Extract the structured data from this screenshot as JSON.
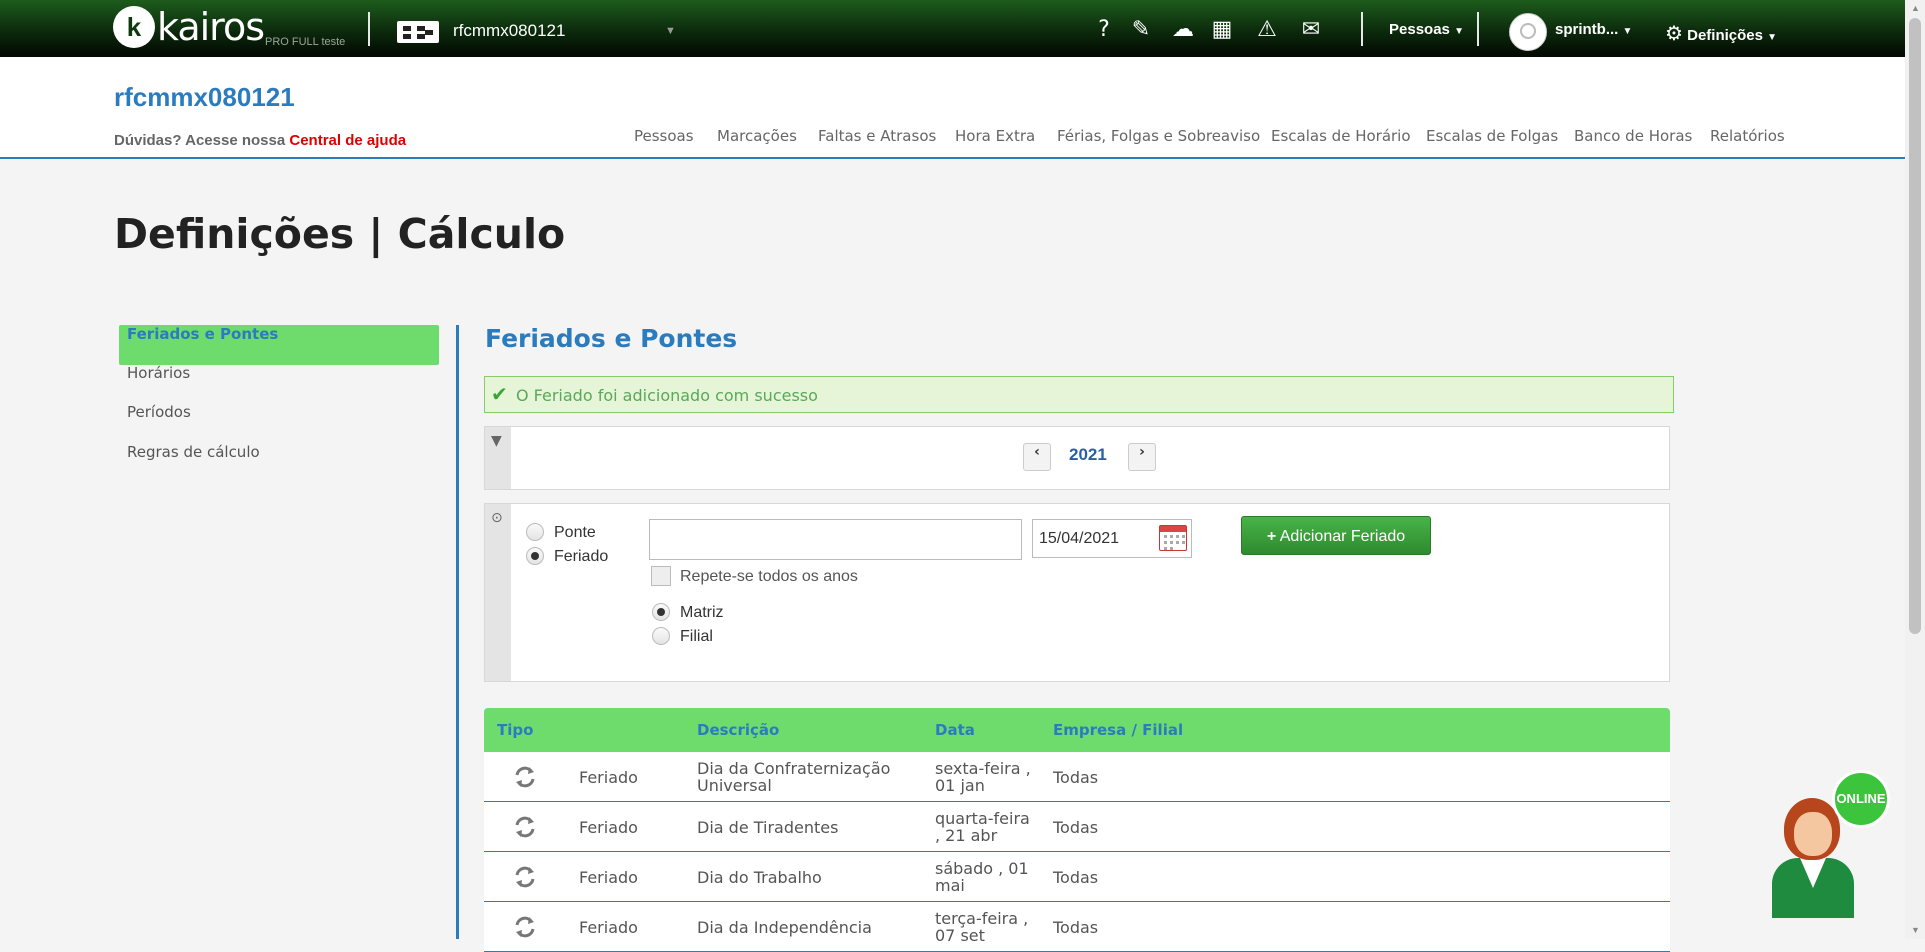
{
  "topbar": {
    "logo_text": "kairos",
    "logo_sub": "PRO FULL teste",
    "company": "rfcmmx080121",
    "icons": [
      "help-icon",
      "chat-support-icon",
      "cloud-upload-icon",
      "calculator-icon",
      "warning-icon",
      "inbox-icon"
    ],
    "icon_glyphs": [
      "?",
      "✎",
      "☁",
      "▦",
      "⚠",
      "✉"
    ],
    "people_menu": "Pessoas",
    "user_name": "sprintb...",
    "settings_menu": "Definições"
  },
  "header": {
    "title": "rfcmmx080121",
    "help_prefix": "Dúvidas? Acesse nossa",
    "help_link": "Central de ajuda",
    "nav": [
      "Pessoas",
      "Marcações",
      "Faltas e Atrasos",
      "Hora Extra",
      "Férias, Folgas e Sobreaviso",
      "Escalas de Horário",
      "Escalas de Folgas",
      "Banco de Horas",
      "Relatórios"
    ]
  },
  "page_title": "Definições | Cálculo",
  "sidebar": {
    "items": [
      "Feriados e Pontes",
      "Horários",
      "Períodos",
      "Regras de cálculo"
    ]
  },
  "section": {
    "title": "Feriados e Pontes",
    "alert": "O Feriado foi adicionado com sucesso"
  },
  "year_filter": {
    "year": "2021",
    "prev": "‹",
    "next": "›"
  },
  "form": {
    "type_bridge": "Ponte",
    "type_holiday": "Feriado",
    "description_value": "",
    "date_value": "15/04/2021",
    "repeat_label": "Repete-se todos os anos",
    "scope_head": "Matriz",
    "scope_branch": "Filial",
    "add_button": "Adicionar Feriado",
    "add_icon": "+"
  },
  "table": {
    "headers": [
      "Tipo",
      "Descrição",
      "Data",
      "Empresa / Filial"
    ],
    "rows": [
      {
        "type": "Feriado",
        "description_1": "Dia da Confraternização",
        "description_2": "Universal",
        "date_1": "sexta-feira ,",
        "date_2": "01 jan",
        "company": "Todas"
      },
      {
        "type": "Feriado",
        "description_1": "Dia de Tiradentes",
        "description_2": "",
        "date_1": "quarta-feira",
        "date_2": ", 21 abr",
        "company": "Todas"
      },
      {
        "type": "Feriado",
        "description_1": "Dia do Trabalho",
        "description_2": "",
        "date_1": "sábado , 01",
        "date_2": "mai",
        "company": "Todas"
      },
      {
        "type": "Feriado",
        "description_1": "Dia da Independência",
        "description_2": "",
        "date_1": "terça-feira ,",
        "date_2": "07 set",
        "company": "Todas"
      }
    ]
  },
  "chat": {
    "status": "ONLINE"
  },
  "colors": {
    "accent_blue": "#2b7bbf",
    "green_active": "#6ddc6d",
    "button_green": "#3a9e3a",
    "link_red": "#e00000"
  }
}
